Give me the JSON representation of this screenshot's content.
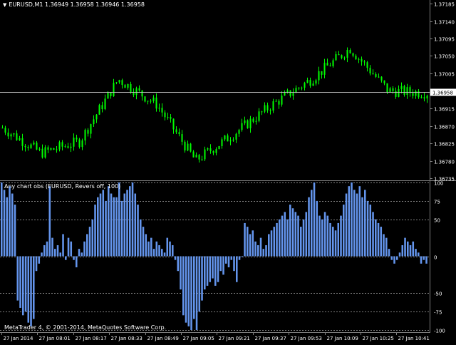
{
  "window": {
    "symbol_header": "EURUSD,M1",
    "ohlc": "1.36949 1.36958 1.36946 1.36958"
  },
  "price_axis": {
    "labels": [
      "1.37185",
      "1.37140",
      "1.37095",
      "1.37050",
      "1.37005",
      "1.36958",
      "1.36915",
      "1.36870",
      "1.36825",
      "1.36780",
      "1.36735"
    ],
    "current_price": "1.36958"
  },
  "indicator": {
    "title": "Any chart obs (EURUSD, Revers off, 100)",
    "levels": [
      "100",
      "75",
      "50",
      "0",
      "-50",
      "-75",
      "-100"
    ]
  },
  "copyright": "MetaTrader 4, © 2001-2014, MetaQuotes Software Corp.",
  "time_axis": {
    "labels": [
      "27 Jan 2014",
      "27 Jan 08:01",
      "27 Jan 08:17",
      "27 Jan 08:33",
      "27 Jan 08:49",
      "27 Jan 09:05",
      "27 Jan 09:21",
      "27 Jan 09:37",
      "27 Jan 09:53",
      "27 Jan 10:09",
      "27 Jan 10:25",
      "27 Jan 10:41"
    ]
  },
  "colors": {
    "background": "#000000",
    "candles": "#00ff00",
    "histogram": "#6495ed",
    "grid_level": "#808080",
    "axis_text": "#ffffff"
  },
  "chart_data": [
    {
      "type": "candlestick",
      "symbol": "EURUSD",
      "timeframe": "M1",
      "current_price": 1.36958,
      "ylim": [
        1.36735,
        1.37185
      ],
      "x": [
        "27 Jan 2014",
        "27 Jan 08:01",
        "27 Jan 08:17",
        "27 Jan 08:33",
        "27 Jan 08:49",
        "27 Jan 09:05",
        "27 Jan 09:21",
        "27 Jan 09:37",
        "27 Jan 09:53",
        "27 Jan 10:09",
        "27 Jan 10:25",
        "27 Jan 10:41"
      ],
      "close": [
        1.36865,
        1.368,
        1.3683,
        1.3699,
        1.36925,
        1.3678,
        1.3685,
        1.36925,
        1.3699,
        1.3707,
        1.3696,
        1.36955
      ]
    },
    {
      "type": "bar",
      "title": "Any chart obs (EURUSD, Revers off, 100)",
      "ylim": [
        -100,
        100
      ],
      "levels": [
        100,
        75,
        50,
        0,
        -50,
        -75,
        -100
      ],
      "values": [
        100,
        90,
        80,
        95,
        85,
        70,
        -60,
        -70,
        -80,
        -75,
        -90,
        -95,
        -85,
        -20,
        -10,
        5,
        15,
        20,
        95,
        25,
        10,
        15,
        5,
        30,
        -5,
        25,
        20,
        -5,
        -15,
        10,
        5,
        20,
        30,
        40,
        50,
        70,
        80,
        85,
        90,
        75,
        95,
        85,
        80,
        80,
        100,
        75,
        85,
        90,
        95,
        100,
        85,
        70,
        50,
        40,
        30,
        20,
        25,
        10,
        20,
        15,
        10,
        5,
        25,
        20,
        15,
        -5,
        -20,
        -45,
        -80,
        -90,
        -95,
        -100,
        -85,
        -100,
        -75,
        -60,
        -45,
        -40,
        -35,
        -30,
        -40,
        -35,
        -20,
        -25,
        -10,
        -15,
        -5,
        -20,
        -35,
        -5,
        0,
        45,
        40,
        30,
        35,
        20,
        15,
        25,
        10,
        15,
        30,
        35,
        40,
        45,
        50,
        55,
        60,
        50,
        70,
        65,
        60,
        55,
        40,
        50,
        60,
        80,
        90,
        100,
        75,
        55,
        50,
        60,
        55,
        45,
        40,
        35,
        45,
        55,
        70,
        85,
        95,
        100,
        90,
        85,
        95,
        80,
        90,
        75,
        70,
        60,
        50,
        45,
        40,
        30,
        25,
        10,
        -5,
        -10,
        -5,
        5,
        15,
        25,
        20,
        15,
        20,
        10,
        5,
        -10,
        -5,
        -10
      ]
    }
  ]
}
